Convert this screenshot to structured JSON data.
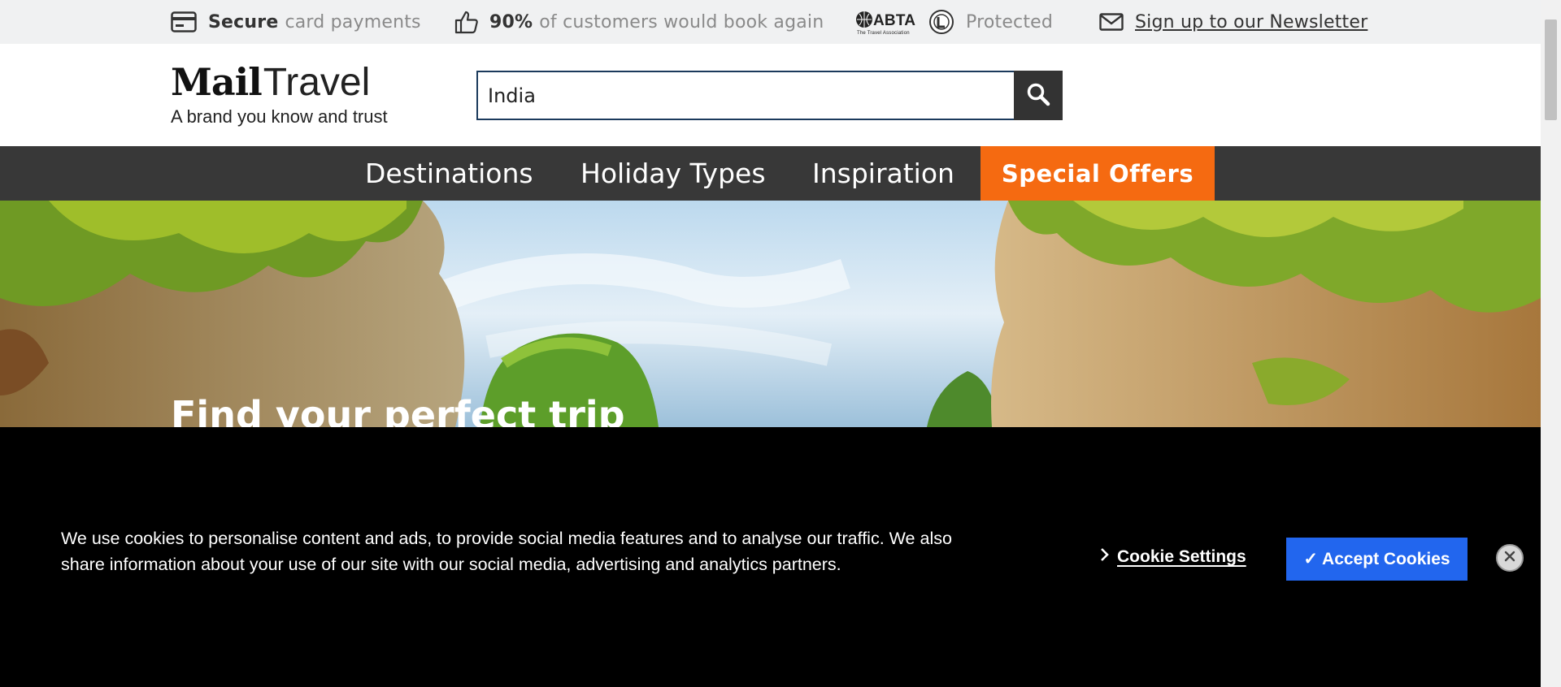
{
  "trust_bar": {
    "secure": {
      "bold": "Secure",
      "text": "card payments",
      "icon": "credit-card-icon"
    },
    "rebook": {
      "bold": "90%",
      "text": "of customers would book again",
      "icon": "thumbs-up-icon"
    },
    "abta": {
      "logo_text": "ABTA",
      "logo_sub": "The Travel Association",
      "text": "Protected",
      "icon": "abta-logo"
    },
    "newsletter": {
      "text": "Sign up to our Newsletter",
      "icon": "envelope-icon"
    }
  },
  "header": {
    "logo": {
      "mail": "Mail",
      "travel": "Travel",
      "tagline": "A brand you know and trust"
    },
    "search": {
      "value": "India",
      "icon": "search-icon"
    }
  },
  "nav": {
    "items": [
      "Destinations",
      "Holiday Types",
      "Inspiration"
    ],
    "offers": "Special Offers"
  },
  "hero": {
    "title": "Find your perfect trip"
  },
  "cookie_banner": {
    "text": "We use cookies to personalise content and ads, to provide social media features and to analyse our traffic. We also share information about your use of our site with our social media, advertising and analytics partners.",
    "settings_label": "Cookie Settings",
    "accept_label": "✓ Accept Cookies",
    "close_icon": "close-icon"
  },
  "colors": {
    "topbar_bg": "#f0f1f2",
    "nav_bg": "#383838",
    "offers_bg": "#f56a11",
    "accept_bg": "#2266ee",
    "banner_bg": "#000000"
  }
}
